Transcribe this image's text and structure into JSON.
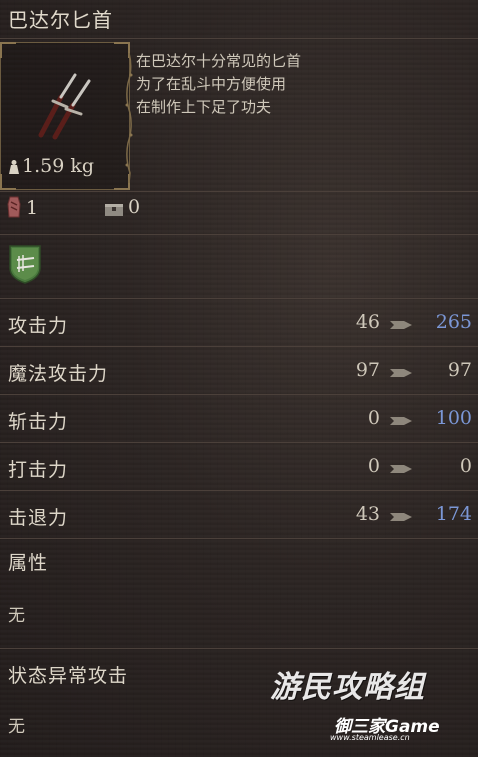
{
  "item": {
    "name": "巴达尔匕首",
    "description": [
      "在巴达尔十分常见的匕首",
      "为了在乱斗中方便使用",
      "在制作上下足了功夫"
    ],
    "weight": "1.59 kg"
  },
  "counts": {
    "owned": "1",
    "stored": "0"
  },
  "stats": [
    {
      "label": "攻击力",
      "base": "46",
      "value": "265",
      "improved": true
    },
    {
      "label": "魔法攻击力",
      "base": "97",
      "value": "97",
      "improved": false
    },
    {
      "label": "斩击力",
      "base": "0",
      "value": "100",
      "improved": true
    },
    {
      "label": "打击力",
      "base": "0",
      "value": "0",
      "improved": false
    },
    {
      "label": "击退力",
      "base": "43",
      "value": "174",
      "improved": true
    }
  ],
  "attribute": {
    "label": "属性",
    "value": "无"
  },
  "status_attack": {
    "label": "状态异常攻击",
    "value": "无"
  },
  "watermark": {
    "line1": "游民攻略组",
    "line2": "御三家Game",
    "line3": "www.steamlease.cn"
  },
  "colors": {
    "improved": "#7b97d6",
    "normal": "#cfc8ba",
    "arrow": "#8e877c",
    "frame": "#6b5b40"
  },
  "icons": {
    "item": "dagger-icon",
    "weight": "weight-icon",
    "owned": "pouch-icon",
    "stored": "chest-icon",
    "class": "shield-daggers-icon",
    "arrow": "arrow-right-icon"
  }
}
